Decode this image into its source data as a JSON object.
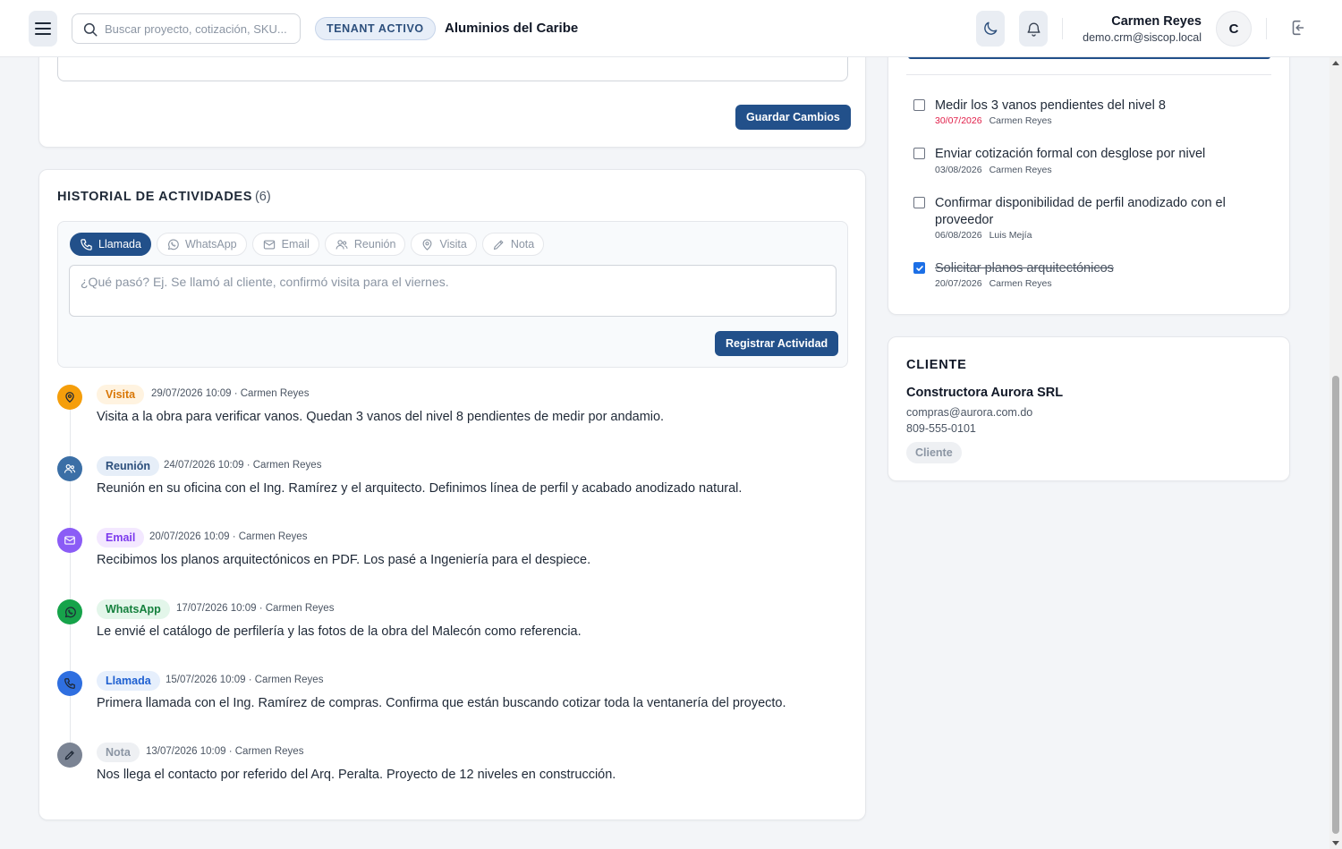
{
  "header": {
    "search_placeholder": "Buscar proyecto, cotización, SKU...",
    "tenant_label": "TENANT ACTIVO",
    "tenant_name": "Aluminios del Caribe",
    "user_name": "Carmen Reyes",
    "user_email": "demo.crm@siscop.local",
    "avatar_initial": "C"
  },
  "form": {
    "save_label": "Guardar Cambios"
  },
  "history": {
    "title": "HISTORIAL DE ACTIVIDADES",
    "count": "(6)",
    "types": [
      {
        "label": "Llamada",
        "icon": "phone-icon"
      },
      {
        "label": "WhatsApp",
        "icon": "whatsapp-icon"
      },
      {
        "label": "Email",
        "icon": "mail-icon"
      },
      {
        "label": "Reunión",
        "icon": "users-icon"
      },
      {
        "label": "Visita",
        "icon": "map-pin-icon"
      },
      {
        "label": "Nota",
        "icon": "pencil-icon"
      }
    ],
    "input_placeholder": "¿Qué pasó? Ej. Se llamó al cliente, confirmó visita para el viernes.",
    "submit_label": "Registrar Actividad",
    "entries": [
      {
        "type": "Visita",
        "meta": "29/07/2026 10:09 · Carmen Reyes",
        "text": "Visita a la obra para verificar vanos. Quedan 3 vanos del nivel 8 pendientes de medir por andamio."
      },
      {
        "type": "Reunión",
        "meta": "24/07/2026 10:09 · Carmen Reyes",
        "text": "Reunión en su oficina con el Ing. Ramírez y el arquitecto. Definimos línea de perfil y acabado anodizado natural."
      },
      {
        "type": "Email",
        "meta": "20/07/2026 10:09 · Carmen Reyes",
        "text": "Recibimos los planos arquitectónicos en PDF. Los pasé a Ingeniería para el despiece."
      },
      {
        "type": "WhatsApp",
        "meta": "17/07/2026 10:09 · Carmen Reyes",
        "text": "Le envié el catálogo de perfilería y las fotos de la obra del Malecón como referencia."
      },
      {
        "type": "Llamada",
        "meta": "15/07/2026 10:09 · Carmen Reyes",
        "text": "Primera llamada con el Ing. Ramírez de compras. Confirma que están buscando cotizar toda la ventanería del proyecto."
      },
      {
        "type": "Nota",
        "meta": "13/07/2026 10:09 · Carmen Reyes",
        "text": "Nos llega el contacto por referido del Arq. Peralta. Proyecto de 12 niveles en construcción."
      }
    ]
  },
  "tasks": [
    {
      "text": "Medir los 3 vanos pendientes del nivel 8",
      "date": "30/07/2026",
      "owner": "Carmen Reyes",
      "done": false,
      "overdue": true
    },
    {
      "text": "Enviar cotización formal con desglose por nivel",
      "date": "03/08/2026",
      "owner": "Carmen Reyes",
      "done": false,
      "overdue": false
    },
    {
      "text": "Confirmar disponibilidad de perfil anodizado con el proveedor",
      "date": "06/08/2026",
      "owner": "Luis Mejía",
      "done": false,
      "overdue": false
    },
    {
      "text": "Solicitar planos arquitectónicos",
      "date": "20/07/2026",
      "owner": "Carmen Reyes",
      "done": true,
      "overdue": false
    }
  ],
  "client": {
    "heading": "CLIENTE",
    "name": "Constructora Aurora SRL",
    "email": "compras@aurora.com.do",
    "phone": "809-555-0101",
    "badge": "Cliente"
  },
  "colors": {
    "primary": "#22508a",
    "visita": "#f59e0b",
    "reunion": "#3b6fa6",
    "email": "#8b5cf6",
    "whatsapp": "#16a34a",
    "llamada": "#2f6fe0",
    "nota": "#7b8494",
    "overdue": "#e11d48"
  }
}
